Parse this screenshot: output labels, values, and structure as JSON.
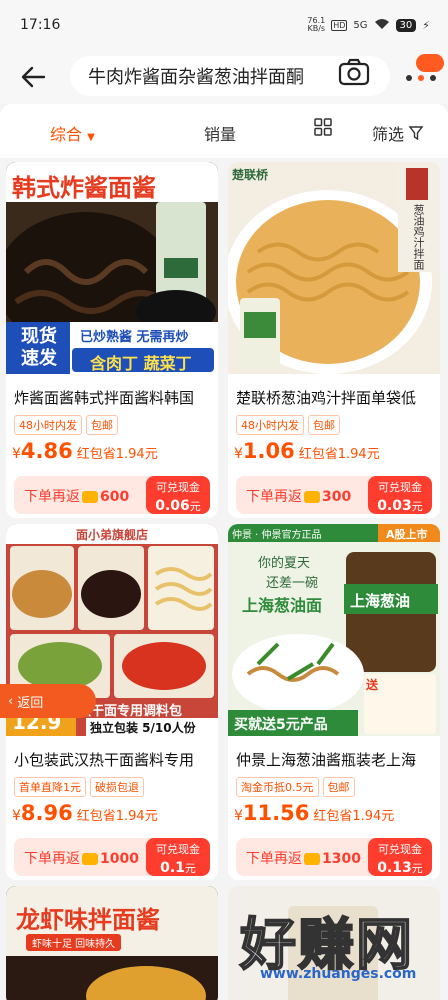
{
  "status": {
    "time": "17:16",
    "net_speed": "76.1",
    "net_unit": "KB/s",
    "hd": "HD",
    "signal": "5G",
    "battery": "30"
  },
  "search": {
    "query": "牛肉炸酱面杂酱葱油拌面酮"
  },
  "filters": {
    "composite": "综合",
    "sales": "销量",
    "filter": "筛选"
  },
  "products": [
    {
      "title": "炸酱面酱韩式拌面酱料韩国",
      "tags": [
        "48小时内发",
        "包邮"
      ],
      "price": "4.86",
      "price_note": "红包省1.94元",
      "rebate_prefix": "下单再返",
      "rebate_amount": "600",
      "cash_label": "可兑现金",
      "cash_value": "0.06",
      "cash_unit": "元",
      "img_lines": [
        "韩式炸酱面酱",
        "现货",
        "速发",
        "已炒熟酱 无需再炒",
        "含肉丁 蔬菜丁"
      ]
    },
    {
      "title": "楚联桥葱油鸡汁拌面单袋低",
      "tags": [
        "48小时内发",
        "包邮"
      ],
      "price": "1.06",
      "price_note": "红包省1.94元",
      "rebate_prefix": "下单再返",
      "rebate_amount": "300",
      "cash_label": "可兑现金",
      "cash_value": "0.03",
      "cash_unit": "元",
      "img_lines": [
        "楚联桥",
        "葱油鸡汁拌面"
      ]
    },
    {
      "title": "小包装武汉热干面酱料专用",
      "tags": [
        "首单直降1元",
        "破损包退"
      ],
      "price": "8.96",
      "price_note": "红包省1.94元",
      "rebate_prefix": "下单再返",
      "rebate_amount": "1000",
      "cash_label": "可兑现金",
      "cash_value": "0.1",
      "cash_unit": "元",
      "img_lines": [
        "面小弟旗舰店",
        "热干面专用调料包",
        "独立包装 5/10人份",
        "12.9"
      ]
    },
    {
      "title": "仲景上海葱油酱瓶装老上海",
      "tags": [
        "淘金币抵0.5元",
        "包邮"
      ],
      "price": "11.56",
      "price_note": "红包省1.94元",
      "rebate_prefix": "下单再返",
      "rebate_amount": "1300",
      "cash_label": "可兑现金",
      "cash_value": "0.13",
      "cash_unit": "元",
      "img_lines": [
        "仲景 · 仲景官方正品",
        "A股上市",
        "你的夏天",
        "还差一碗",
        "上海葱油面",
        "上海葱油",
        "买就送5元产品",
        "送"
      ]
    }
  ],
  "bottom_cards": {
    "left_text": "龙虾味拌面酱",
    "left_sub": "虾味十足 回味持久"
  },
  "back_float": "返回",
  "watermark": {
    "big": "好赚网",
    "small": "www.zhuanges.com"
  },
  "colors": {
    "accent": "#ff5000",
    "rebate_red": "#ff3d2e"
  }
}
